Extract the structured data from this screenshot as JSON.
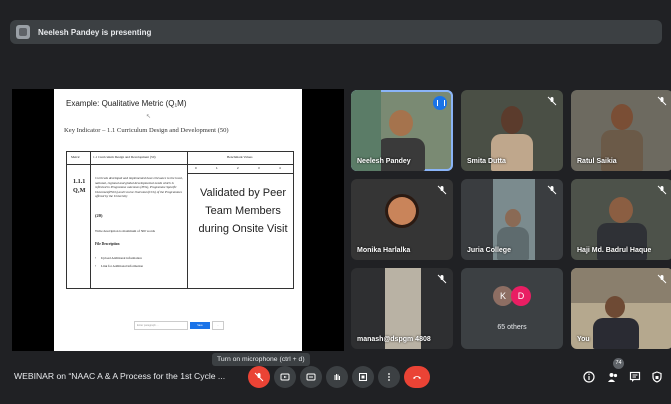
{
  "presenter_bar": {
    "text": "Neelesh Pandey is presenting"
  },
  "slide": {
    "title": "Example: Qualitative Metric (Q₁M)",
    "key_indicator": "Key Indicator – 1.1 Curriculum Design and Development (50)",
    "table": {
      "col_metric": "Metric",
      "col_title": "1.1 Curriculum Design and Development (50)",
      "col_benchmark": "Benchmark Values",
      "benchmark_levels": [
        "0",
        "1",
        "2",
        "3",
        "4"
      ],
      "row_id": "1.1.1",
      "row_type": "Q₁M",
      "row_desc": "Curricula developed and implemented have relevance to the local, national, regional and global developmental needs which is reflected in Programme outcomes (POs), Programme Specific Outcomes(PSOs) and Course Outcomes(COs) of the Programmes offered by the University",
      "row_weight": "(20)",
      "write_desc": "Write description is maximum of 500 words",
      "file_desc": "File Description",
      "bullets": [
        "Upload Additional information",
        "Link for Additional information"
      ],
      "validated_text": "Validated by Peer Team Members during Onsite Visit"
    },
    "input_placeholder_1": "Enter paragraph ...",
    "button_label": "Save",
    "button_label_2": "..."
  },
  "tiles": [
    {
      "name": "Neelesh Pandey",
      "speaking": true
    },
    {
      "name": "Smita Dutta",
      "muted": true
    },
    {
      "name": "Ratul Saikia",
      "muted": true
    },
    {
      "name": "Monika Harlalka",
      "muted": true
    },
    {
      "name": "Juria College",
      "muted": true
    },
    {
      "name": "Haji Md. Badrul Haque",
      "muted": true
    },
    {
      "name": "manash@dspgm 4808",
      "muted": true
    },
    {
      "name": "65 others",
      "avatars": [
        "K",
        "D"
      ]
    },
    {
      "name": "You",
      "muted": true
    }
  ],
  "bottom": {
    "meeting_title": "WEBINAR on “NAAC A & A Process for the 1st Cycle ...",
    "tooltip": "Turn on microphone (ctrl + d)",
    "participants_count": "74"
  },
  "colors": {
    "accent": "#1a73e8",
    "danger": "#ea4335",
    "avatar_k": "#8d6e63",
    "avatar_d": "#e91e63"
  },
  "icons": [
    "mic-off-icon",
    "present-icon",
    "captions-icon",
    "hand-icon",
    "screen-icon",
    "more-icon",
    "hangup-icon",
    "info-icon",
    "people-icon",
    "chat-icon",
    "lock-icon"
  ]
}
